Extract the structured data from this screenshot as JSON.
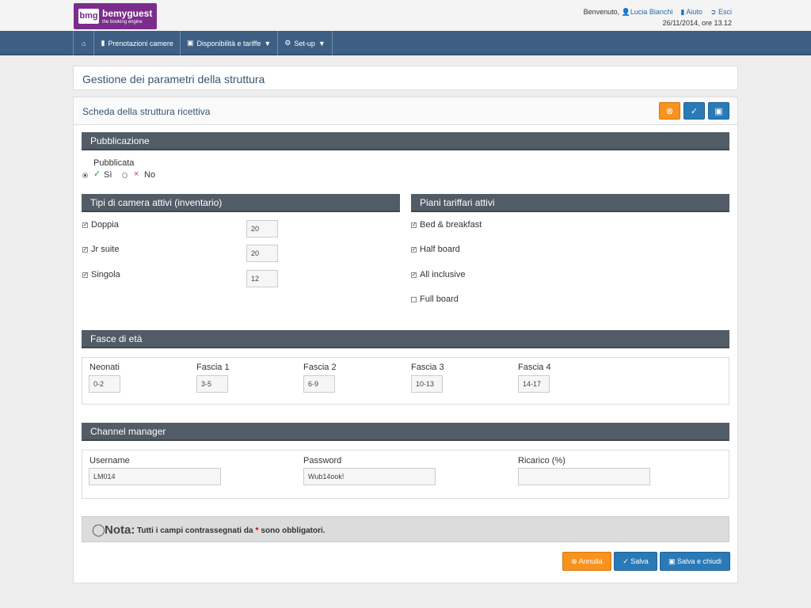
{
  "brand": {
    "mark": "bmg",
    "name": "bemyguest",
    "tagline": "the booking engine",
    "color": "#7b2d8b"
  },
  "user": {
    "welcome": "Benvenuto,",
    "name": "Lucia Bianchi",
    "help": "Aiuto",
    "logout": "Esci",
    "datetime": "26/11/2014, ore 13.12"
  },
  "nav": {
    "home_icon": "home-icon",
    "items": [
      {
        "label": "Prenotazioni camere",
        "icon": "book-icon"
      },
      {
        "label": "Disponibilità e tariffe",
        "icon": "calendar-icon",
        "caret": "▼"
      },
      {
        "label": "Set-up",
        "icon": "gear-icon",
        "caret": "▼"
      }
    ]
  },
  "page_title": "Gestione dei parametri della struttura",
  "form": {
    "title": "Scheda della struttura ricettiva",
    "publication": {
      "header": "Pubblicazione",
      "label": "Pubblicata",
      "yes": "Sì",
      "no": "No",
      "selected": "Sì"
    },
    "rooms": {
      "header": "Tipi di camera attivi (inventario)",
      "items": [
        {
          "label": "Doppia",
          "checked": true,
          "value": "20"
        },
        {
          "label": "Jr suite",
          "checked": true,
          "value": "20"
        },
        {
          "label": "Singola",
          "checked": true,
          "value": "12"
        }
      ]
    },
    "plans": {
      "header": "Piani tariffari attivi",
      "items": [
        {
          "label": "Bed & breakfast",
          "checked": true
        },
        {
          "label": "Half board",
          "checked": true
        },
        {
          "label": "All inclusive",
          "checked": true
        },
        {
          "label": "Full board",
          "checked": false
        }
      ]
    },
    "ages": {
      "header": "Fasce di età",
      "items": [
        {
          "label": "Neonati",
          "value": "0-2"
        },
        {
          "label": "Fascia 1",
          "value": "3-5"
        },
        {
          "label": "Fascia 2",
          "value": "6-9"
        },
        {
          "label": "Fascia 3",
          "value": "10-13"
        },
        {
          "label": "Fascia 4",
          "value": "14-17"
        }
      ]
    },
    "channel": {
      "header": "Channel manager",
      "username_label": "Username",
      "username": "LM014",
      "password_label": "Password",
      "password": "Wub14ook!",
      "surcharge_label": "Ricarico (%)",
      "surcharge": ""
    },
    "note": {
      "title": "Nota:",
      "text": "Tutti i campi contrassegnati da",
      "star": "*",
      "text2": "sono obbligatori."
    },
    "buttons": {
      "cancel": "Annulla",
      "save": "Salva",
      "save_close": "Salva e chiudi"
    }
  },
  "colors": {
    "nav": "#3e5f84",
    "section": "#515c66",
    "orange": "#f7931e",
    "blue": "#2a7ab8"
  }
}
